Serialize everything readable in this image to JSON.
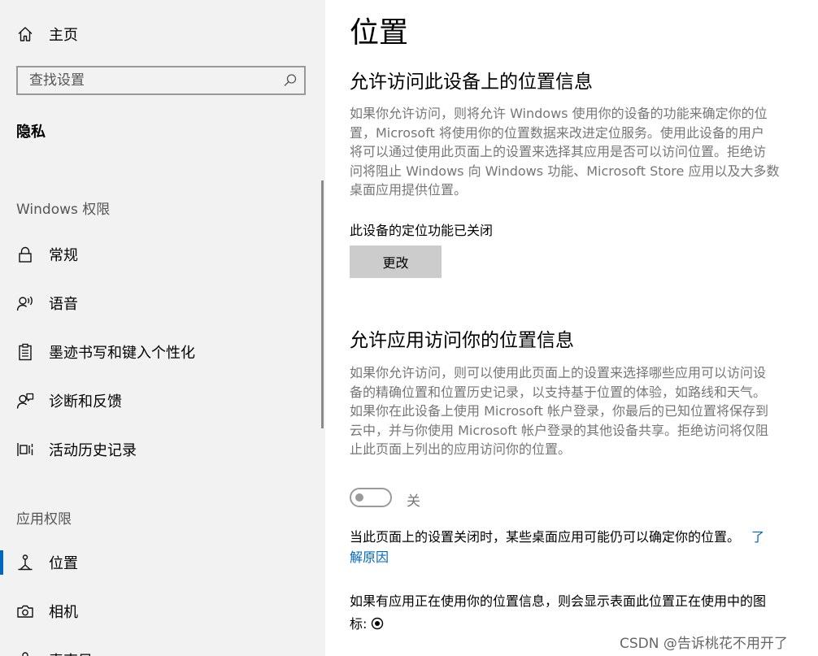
{
  "sidebar": {
    "home_label": "主页",
    "search_placeholder": "查找设置",
    "category": "隐私",
    "windows_perm_header": "Windows 权限",
    "windows_items": [
      {
        "label": "常规",
        "icon": "lock-icon"
      },
      {
        "label": "语音",
        "icon": "speech-icon"
      },
      {
        "label": "墨迹书写和键入个性化",
        "icon": "clipboard-icon"
      },
      {
        "label": "诊断和反馈",
        "icon": "person-feedback-icon"
      },
      {
        "label": "活动历史记录",
        "icon": "activity-history-icon"
      }
    ],
    "app_perm_header": "应用权限",
    "app_items": [
      {
        "label": "位置",
        "icon": "location-icon",
        "active": true
      },
      {
        "label": "相机",
        "icon": "camera-icon"
      },
      {
        "label": "麦克风",
        "icon": "microphone-icon"
      }
    ]
  },
  "main": {
    "title": "位置",
    "section1": {
      "heading": "允许访问此设备上的位置信息",
      "desc_lines": [
        "如果你允许访问，则将允许 Windows 使用你的设备的功能来确定你的位",
        "置，Microsoft 将使用你的位置数据来改进定位服务。使用此设备的用户",
        "将可以通过使用此页面上的设置来选择其应用是否可以访问位置。拒绝访",
        "问将阻止 Windows 向 Windows 功能、Microsoft Store 应用以及大多数",
        "桌面应用提供位置。"
      ],
      "status": "此设备的定位功能已关闭",
      "button_label": "更改"
    },
    "section2": {
      "heading": "允许应用访问你的位置信息",
      "desc_lines": [
        "如果你允许访问，则可以使用此页面上的设置来选择哪些应用可以访问设",
        "备的精确位置和位置历史记录，以支持基于位置的体验，如路线和天气。",
        "如果你在此设备上使用 Microsoft 帐户登录，你最后的已知位置将保存到",
        "云中，并与你使用 Microsoft 帐户登录的其他设备共享。拒绝访问将仅阻",
        "止此页面上列出的应用访问你的位置。"
      ],
      "toggle_label": "关",
      "toggle_on": false,
      "note_text": "当此页面上的设置关闭时，某些桌面应用可能仍可以确定你的位置。",
      "note_link_part1": "了",
      "note_link_part2": "解原因",
      "usage_line1": "如果有应用正在使用你的位置信息，则会显示表面此位置正在使用中的图",
      "usage_line2": "标: "
    }
  },
  "watermark": "CSDN @告诉桃花不用开了",
  "colors": {
    "accent": "#0067c0",
    "sidebar_bg": "#f2f2f2",
    "muted_text": "#767676"
  }
}
